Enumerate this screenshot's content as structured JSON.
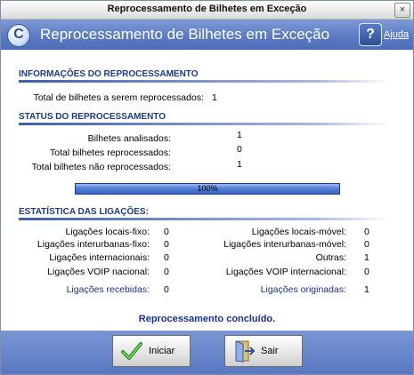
{
  "window": {
    "title": "Reprocessamento de Bilhetes em Exceção",
    "close_symbol": "×"
  },
  "header": {
    "title": "Reprocessamento de Bilhetes em Exceção",
    "help_label": "Ajuda",
    "logo_icon": "app-logo-icon",
    "help_icon": "question-mark-icon"
  },
  "info": {
    "heading": "INFORMAÇÕES DO REPROCESSAMENTO",
    "total_label": "Total de bilhetes a serem reprocessados:",
    "total_value": "1"
  },
  "status": {
    "heading": "STATUS DO REPROCESSAMENTO",
    "rows": [
      {
        "label": "Bilhetes analisados:",
        "value": "1"
      },
      {
        "label": "Total bilhetes reprocessados:",
        "value": "0"
      },
      {
        "label": "Total bilhetes não reprocessados:",
        "value": "1"
      }
    ],
    "progress_label": "100%",
    "progress_percent": 100
  },
  "stats": {
    "heading": "ESTATÍSTICA DAS LIGAÇÕES:",
    "left": [
      {
        "label": "Ligações locais-fixo:",
        "value": "0"
      },
      {
        "label": "Ligações interurbanas-fixo:",
        "value": "0"
      },
      {
        "label": "Ligações internacionais:",
        "value": "0"
      },
      {
        "label": "Ligações VOIP nacional:",
        "value": "0"
      },
      {
        "label": "Ligações recebidas:",
        "value": "0"
      }
    ],
    "right": [
      {
        "label": "Ligações locais-móvel:",
        "value": "0"
      },
      {
        "label": "Ligações interurbanas-móvel:",
        "value": "0"
      },
      {
        "label": "Outras:",
        "value": "1"
      },
      {
        "label": "Ligações VOIP internacional:",
        "value": "0"
      },
      {
        "label": "Ligações originadas:",
        "value": "1"
      }
    ]
  },
  "message": "Reprocessamento concluído.",
  "buttons": {
    "start_label": "Iniciar",
    "exit_label": "Sair"
  },
  "colors": {
    "header": "#5a78c2",
    "section_text": "#1a3a8a",
    "link_blue": "#1a2f8f",
    "progress": "#4f7cd2"
  }
}
